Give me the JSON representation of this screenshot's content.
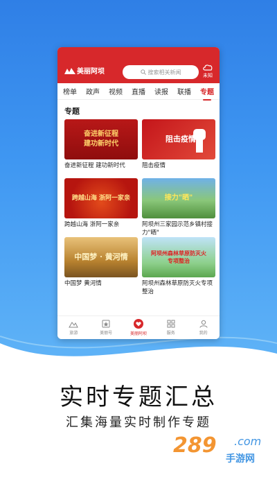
{
  "header": {
    "logo_text": "美丽阿坝",
    "search_placeholder": "搜索相关新闻",
    "weather_label": "未知"
  },
  "tabs": [
    {
      "label": "榜单"
    },
    {
      "label": "政声"
    },
    {
      "label": "视频"
    },
    {
      "label": "直播"
    },
    {
      "label": "读报"
    },
    {
      "label": "联播"
    },
    {
      "label": "专题",
      "active": true
    }
  ],
  "section": {
    "title": "专题"
  },
  "cards": [
    {
      "caption": "奋进新征程 建功新时代",
      "thumb_text": "奋进新征程\n建功新时代"
    },
    {
      "caption": "阻击疫情",
      "thumb_text": "阻击疫情"
    },
    {
      "caption": "跨越山海 浙阿一家亲",
      "thumb_text": "跨越山海 浙阿一家亲"
    },
    {
      "caption": "阿坝州三家园示范乡镇村接力\"晒\"",
      "thumb_text": "接力\"晒\""
    },
    {
      "caption": "中国梦 黄河情",
      "thumb_text": "中国梦 · 黄河情"
    },
    {
      "caption": "阿坝州森林草原防灭火专项整治",
      "thumb_text": "阿坝州森林草原防灭火\n专项整治"
    }
  ],
  "bottom_nav": [
    {
      "label": "旅游",
      "icon": "mountain-icon"
    },
    {
      "label": "美丽号",
      "icon": "star-badge-icon"
    },
    {
      "label": "美丽阿坝",
      "icon": "heart-icon",
      "active": true
    },
    {
      "label": "服务",
      "icon": "grid-icon"
    },
    {
      "label": "我的",
      "icon": "person-icon"
    }
  ],
  "promo": {
    "headline": "实时专题汇总",
    "subline": "汇集海量实时制作专题"
  },
  "watermark": {
    "number": "289",
    "domain": ".com",
    "site_name": "手游网"
  },
  "colors": {
    "brand_red": "#d7282b",
    "background_blue": "#3f97f2"
  }
}
